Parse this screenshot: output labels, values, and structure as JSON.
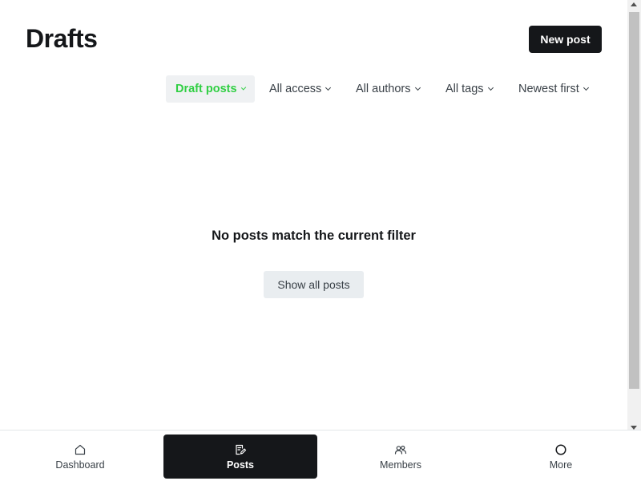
{
  "header": {
    "title": "Drafts",
    "new_post_label": "New post"
  },
  "filters": {
    "type": "Draft posts",
    "access": "All access",
    "authors": "All authors",
    "tags": "All tags",
    "order": "Newest first"
  },
  "empty_state": {
    "message": "No posts match the current filter",
    "button_label": "Show all posts"
  },
  "bottom_nav": {
    "items": [
      {
        "label": "Dashboard",
        "icon": "home-icon"
      },
      {
        "label": "Posts",
        "icon": "posts-icon",
        "active": true
      },
      {
        "label": "Members",
        "icon": "members-icon"
      },
      {
        "label": "More",
        "icon": "more-circle-icon"
      }
    ]
  },
  "colors": {
    "accent": "#30cf43",
    "primary_dark": "#15171a",
    "filter_bg": "#eff1f3"
  }
}
